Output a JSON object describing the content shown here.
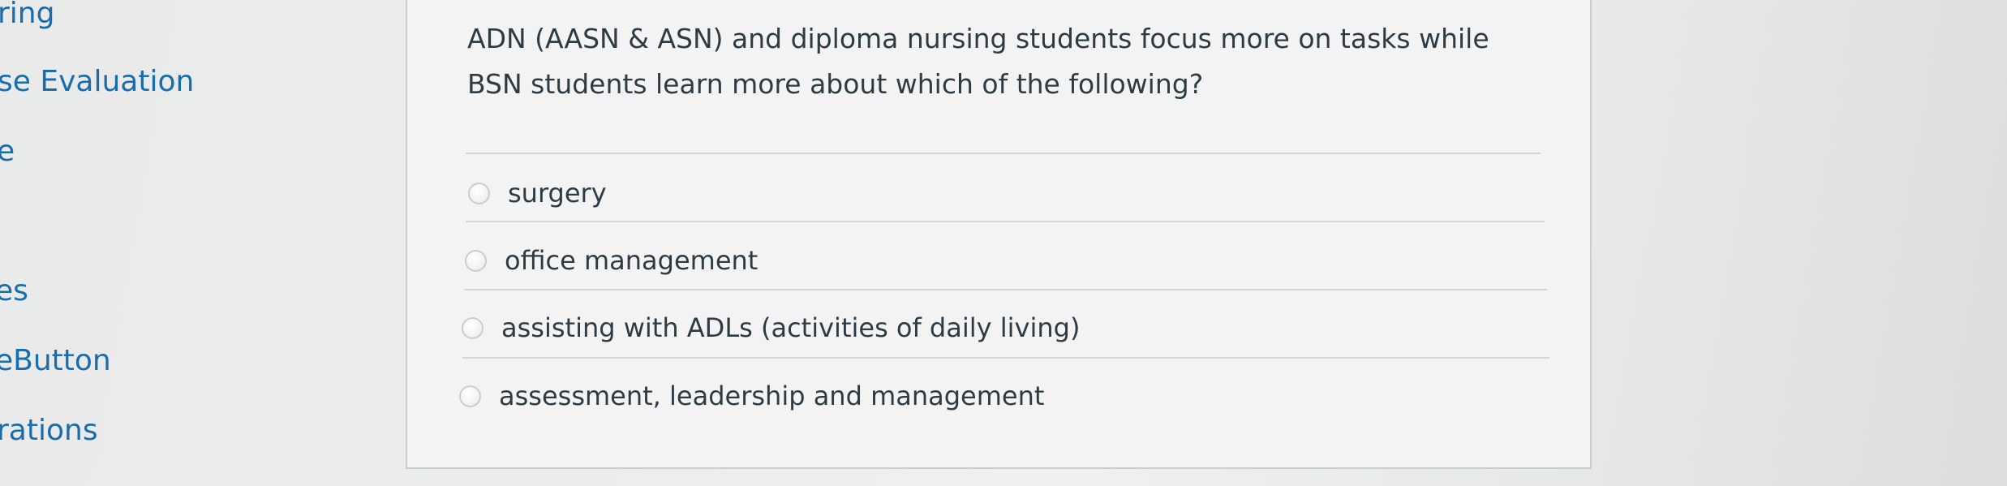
{
  "sidebar": {
    "items": [
      {
        "label": "ring"
      },
      {
        "label": "se Evaluation"
      },
      {
        "label": "e"
      },
      {
        "label": "es"
      },
      {
        "label": "eButton"
      },
      {
        "label": "rations"
      }
    ]
  },
  "question": {
    "text": "ADN (AASN & ASN) and diploma nursing students focus more on tasks while BSN students learn more about which of the following?",
    "answers": [
      {
        "label": "surgery",
        "selected": false
      },
      {
        "label": "office management",
        "selected": false
      },
      {
        "label": "assisting with ADLs (activities of daily living)",
        "selected": false
      },
      {
        "label": "assessment, leadership and management",
        "selected": false
      }
    ]
  },
  "colors": {
    "nav_link": "#1a6dac",
    "text": "#2d3b45",
    "border": "#c7cdd1",
    "card_background": "#f3f3f3"
  }
}
